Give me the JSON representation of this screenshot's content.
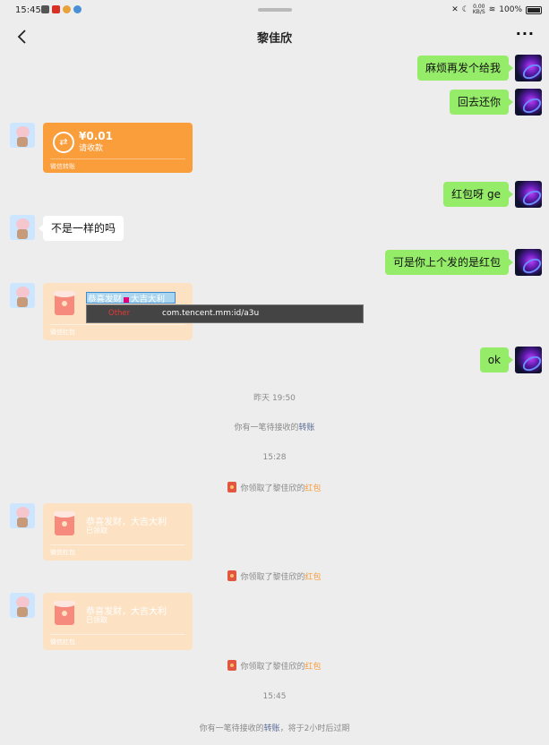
{
  "status_bar": {
    "time": "15:45",
    "speed": "0.00",
    "speed_unit": "KB/S",
    "battery": "100%"
  },
  "header": {
    "title": "黎佳欣",
    "more": "···"
  },
  "messages": {
    "m1": "麻烦再发个给我",
    "m2": "回去还你",
    "transfer": {
      "amount": "¥0.01",
      "sub": "请收款",
      "foot": "微信转账"
    },
    "m3": "红包呀 ge",
    "m4": "不是一样的吗",
    "m5": "可是你上个发的是红包",
    "redpack_selected": {
      "title_left": "恭喜发财",
      "title_right": "大吉大利",
      "foot": "微信红包"
    },
    "m6": "ok",
    "redpack2": {
      "title": "恭喜发财，大吉大利",
      "sub": "已领取",
      "foot": "微信红包"
    },
    "redpack3": {
      "title": "恭喜发财，大吉大利",
      "sub": "已领取",
      "foot": "微信红包"
    }
  },
  "tooltip": {
    "type": "Other",
    "id": "com.tencent.mm:id/a3u"
  },
  "system": {
    "time1": "昨天 19:50",
    "transfer_pending_prefix": "你有一笔待接收的",
    "transfer_link": "转账",
    "time2": "15:28",
    "received_prefix": "你领取了黎佳欣的",
    "redpack_link": "红包",
    "time3": "15:45",
    "transfer_pending2_prefix": "你有一笔待接收的",
    "transfer_pending2_suffix": "，将于2小时后过期"
  },
  "colors": {
    "bg": "#ededed",
    "bubble_me": "#95ec69",
    "transfer": "#fa9d3b",
    "redpack_received": "#fde1c3",
    "link": "#576b95"
  }
}
